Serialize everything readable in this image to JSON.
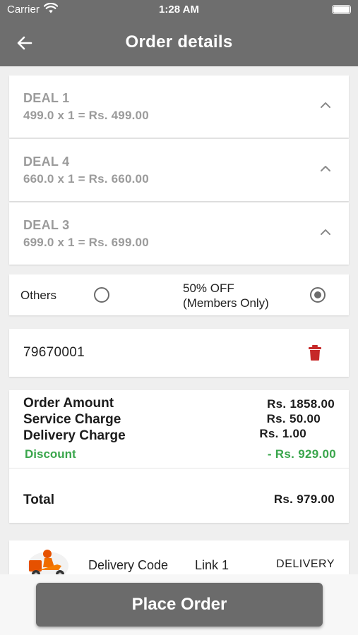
{
  "status_bar": {
    "carrier": "Carrier",
    "time": "1:28 AM"
  },
  "header": {
    "title": "Order details"
  },
  "deals": [
    {
      "name": "DEAL 1",
      "price_line": "499.0 x 1 = Rs.  499.00"
    },
    {
      "name": "DEAL 4",
      "price_line": "660.0 x 1 = Rs.  660.00"
    },
    {
      "name": "DEAL 3",
      "price_line": "699.0 x 1 = Rs.  699.00"
    }
  ],
  "options": {
    "others_label": "Others",
    "members_label_line1": "50% OFF",
    "members_label_line2": "(Members Only)",
    "selected": "members"
  },
  "phone": {
    "value": "79670001"
  },
  "summary": {
    "order_amount_label": "Order Amount",
    "order_amount_value": "Rs.  1858.00",
    "service_charge_label": "Service Charge",
    "service_charge_value": "Rs.  50.00",
    "delivery_charge_label": "Delivery Charge",
    "delivery_charge_value": "Rs.  1.00",
    "discount_label": "Discount",
    "discount_value": "- Rs.  929.00",
    "total_label": "Total",
    "total_value": "Rs.  979.00"
  },
  "delivery": {
    "code_label": "Delivery Code",
    "link_label": "Link 1",
    "type": "DELIVERY"
  },
  "footer": {
    "place_order_label": "Place Order"
  },
  "colors": {
    "header_bg": "#6e6e6e",
    "discount_green": "#3aa64c",
    "trash_red": "#c62828",
    "button_bg": "#6b6b6b"
  }
}
